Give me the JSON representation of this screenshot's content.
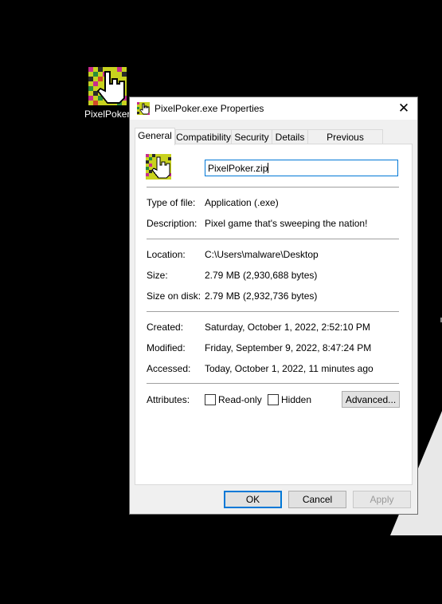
{
  "desktop": {
    "icon_label": "PixelPoker"
  },
  "dialog": {
    "title": "PixelPoker.exe Properties",
    "tabs": [
      "General",
      "Compatibility",
      "Security",
      "Details",
      "Previous Versions"
    ],
    "file_name_value": "PixelPoker.zip",
    "type_of_file": {
      "label": "Type of file:",
      "value": "Application (.exe)"
    },
    "description": {
      "label": "Description:",
      "value": "Pixel game that's sweeping the nation!"
    },
    "location": {
      "label": "Location:",
      "value": "C:\\Users\\malware\\Desktop"
    },
    "size": {
      "label": "Size:",
      "value": "2.79 MB (2,930,688 bytes)"
    },
    "size_on_disk": {
      "label": "Size on disk:",
      "value": "2.79 MB (2,932,736 bytes)"
    },
    "created": {
      "label": "Created:",
      "value": "Saturday, October 1, 2022, 2:52:10 PM"
    },
    "modified": {
      "label": "Modified:",
      "value": "Friday, September 9, 2022, 8:47:24 PM"
    },
    "accessed": {
      "label": "Accessed:",
      "value": "Today, October 1, 2022, 11 minutes ago"
    },
    "attributes": {
      "label": "Attributes:",
      "read_only": "Read-only",
      "hidden": "Hidden",
      "advanced": "Advanced..."
    },
    "buttons": {
      "ok": "OK",
      "cancel": "Cancel",
      "apply": "Apply"
    }
  },
  "colors": {
    "accent": "#0078d7",
    "desktop": "#000000",
    "dialog_bg": "#f0f0f0"
  }
}
